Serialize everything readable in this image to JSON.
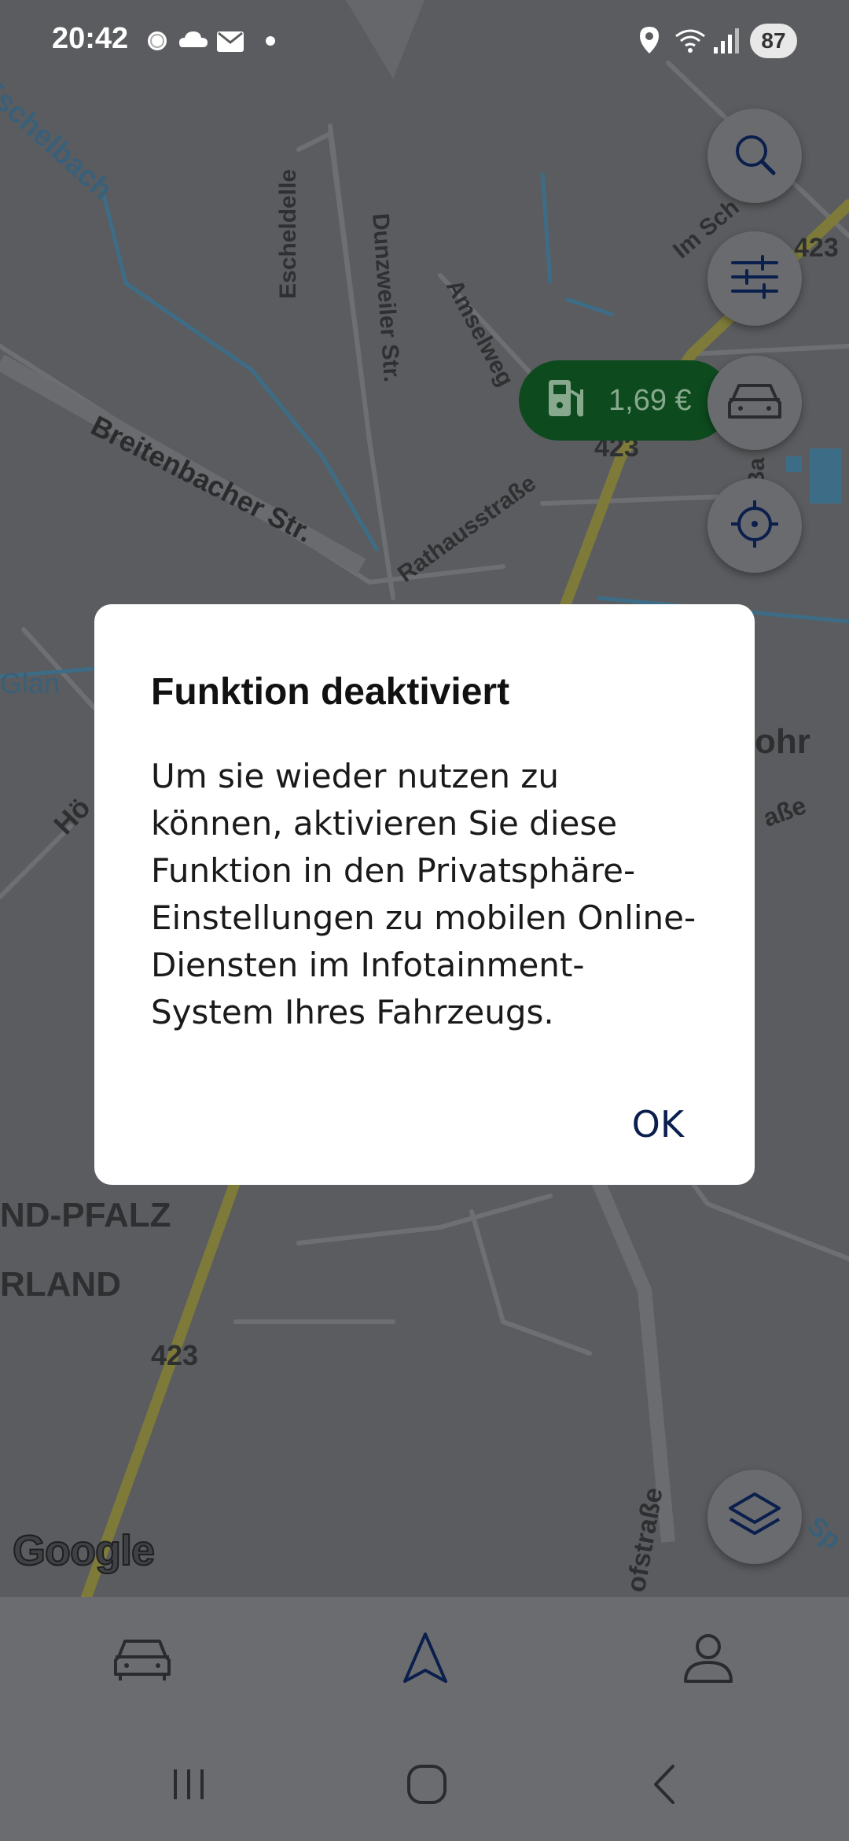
{
  "status_bar": {
    "time": "20:42",
    "battery": "87",
    "icons": [
      "record-icon",
      "cloud-icon",
      "mail-icon",
      "dot-icon",
      "location-icon",
      "wifi-icon",
      "signal-icon"
    ]
  },
  "map": {
    "labels": {
      "eschelbach": "Eschelbach",
      "escheldelle": "Escheldelle",
      "dunzweiler": "Dunzweiler Str.",
      "amselweg": "Amselweg",
      "im_sch": "Im Sch",
      "breitenbacher": "Breitenbacher Str.",
      "rathausstrasse": "Rathausstraße",
      "road_423_a": "423",
      "road_423_b": "423",
      "road_423_c": "423",
      "glan": "Glan",
      "hoe": "Hö",
      "ohr": "ohr",
      "asse": "aße",
      "ba": "Ba",
      "nd_pfalz": "ND-PFALZ",
      "rland": "RLAND",
      "ofstrasse": "ofstraße",
      "sp": "Sp"
    },
    "fuel_price": "1,69 €",
    "attribution": "Google"
  },
  "fabs": [
    "search-icon",
    "filter-sliders-icon",
    "car-icon",
    "locate-crosshair-icon",
    "layers-icon"
  ],
  "dialog": {
    "title": "Funktion deaktiviert",
    "body": "Um sie wieder nutzen zu können, aktivieren Sie diese Funktion in den Privatsphäre-Einstellungen zu mobilen Online-Diensten im Infotainment-System Ihres Fahrzeugs.",
    "ok_label": "OK"
  },
  "colors": {
    "scrim_map": "#5b5c5f",
    "dialog_bg": "#ffffff",
    "accent": "#0b1f4d",
    "price_pill": "#0d4a1e",
    "road_major": "#7d7a3a",
    "water": "#3d6d86"
  }
}
